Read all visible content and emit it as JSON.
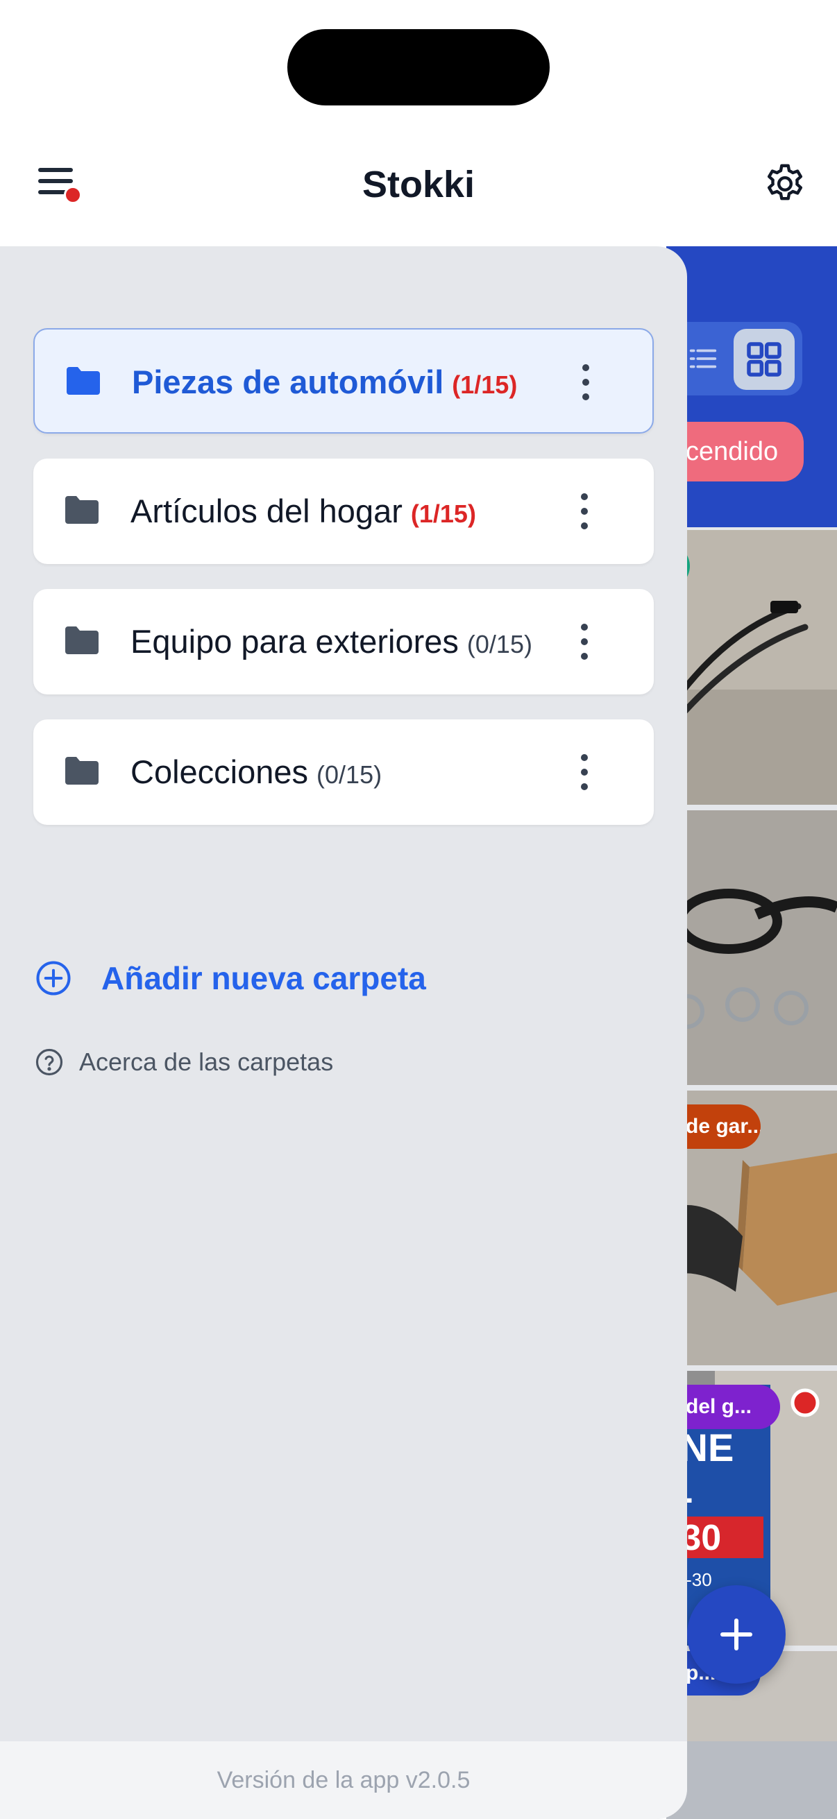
{
  "header": {
    "title": "Stokki",
    "menu_icon": "hamburger-menu-icon",
    "settings_icon": "gear-icon",
    "notification_dot_color": "#dc2626"
  },
  "background": {
    "sort_label": "cendido",
    "view_modes": [
      "list",
      "grid"
    ],
    "selected_view": "grid",
    "cards": [
      {
        "tag": "",
        "tag_color": "#14a37f",
        "image": "wiper-blades"
      },
      {
        "tag": "",
        "tag_color": "#14a37f",
        "image": "hoses-and-clamps"
      },
      {
        "tag": "de gar...",
        "tag_color": "#c2410c",
        "image": "brake-pads-box"
      },
      {
        "tag": "del g...",
        "tag_color": "#7e22ce",
        "image": "motor-oil-can"
      }
    ],
    "bottom_tag": "p..."
  },
  "drawer": {
    "folders": [
      {
        "name": "Piezas de automóvil",
        "count": "(1/15)",
        "over_limit": true,
        "active": true
      },
      {
        "name": "Artículos del hogar",
        "count": "(1/15)",
        "over_limit": true,
        "active": false
      },
      {
        "name": "Equipo para exteriores",
        "count": "(0/15)",
        "over_limit": false,
        "active": false
      },
      {
        "name": "Colecciones",
        "count": "(0/15)",
        "over_limit": false,
        "active": false
      }
    ],
    "add_folder_label": "Añadir nueva carpeta",
    "about_label": "Acerca de las carpetas",
    "version": "Versión de la app v2.0.5"
  },
  "colors": {
    "primary": "#2563eb",
    "active_bg": "#ebf2fe",
    "danger": "#dc2626",
    "drawer_bg": "#e5e7eb"
  }
}
